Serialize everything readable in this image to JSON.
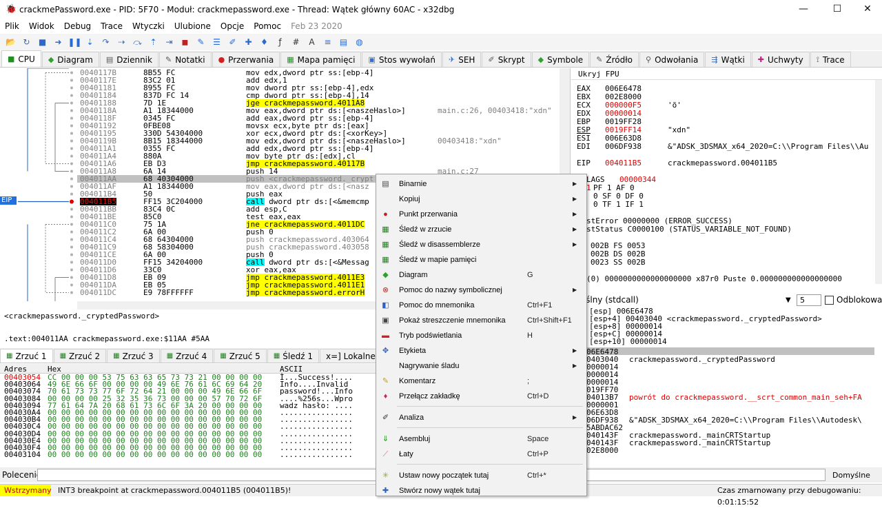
{
  "window": {
    "title": "crackmePassword.exe - PID: 5F70 - Moduł: crackmepassword.exe - Thread: Wątek główny 60AC - x32dbg",
    "controls": [
      "—",
      "☐",
      "✕"
    ]
  },
  "menu": {
    "items": [
      "Plik",
      "Widok",
      "Debug",
      "Trace",
      "Wtyczki",
      "Ulubione",
      "Opcje",
      "Pomoc"
    ],
    "date": "Feb 23 2020"
  },
  "toolbar": {
    "icons": [
      "open-icon",
      "restart-icon",
      "stop-icon",
      "run-icon",
      "pause-icon",
      "step-into-icon",
      "step-over-icon",
      "trace-into-icon",
      "trace-over-icon",
      "execute-till-return-icon",
      "run-to-user-code-icon",
      "animate-icon",
      "breakpoint-icon",
      "patch-icon",
      "comment-icon",
      "label-icon",
      "bookmark-icon",
      "function-icon",
      "hash-icon",
      "font-icon",
      "strings-icon",
      "calculator-icon",
      "help-icon"
    ]
  },
  "tabs": [
    {
      "label": "CPU",
      "icon": "cpu-icon",
      "active": true
    },
    {
      "label": "Diagram",
      "icon": "graph-icon"
    },
    {
      "label": "Dziennik",
      "icon": "log-icon"
    },
    {
      "label": "Notatki",
      "icon": "notes-icon"
    },
    {
      "label": "Przerwania",
      "icon": "breakpoints-icon"
    },
    {
      "label": "Mapa pamięci",
      "icon": "memory-map-icon"
    },
    {
      "label": "Stos wywołań",
      "icon": "callstack-icon"
    },
    {
      "label": "SEH",
      "icon": "seh-icon"
    },
    {
      "label": "Skrypt",
      "icon": "script-icon"
    },
    {
      "label": "Symbole",
      "icon": "symbols-icon"
    },
    {
      "label": "Źródło",
      "icon": "source-icon"
    },
    {
      "label": "Odwołania",
      "icon": "references-icon"
    },
    {
      "label": "Wątki",
      "icon": "threads-icon"
    },
    {
      "label": "Uchwyty",
      "icon": "handles-icon"
    },
    {
      "label": "Trace",
      "icon": "trace-icon"
    }
  ],
  "disasm": {
    "eip_label": "EIP",
    "rows": [
      {
        "addr": "0040117B",
        "bytes": "8B55 FC",
        "dis": "mov edx,dword ptr ss:[ebp-4]",
        "cmt": ""
      },
      {
        "addr": "0040117E",
        "bytes": "83C2 01",
        "dis": "add edx,1",
        "cmt": ""
      },
      {
        "addr": "00401181",
        "bytes": "8955 FC",
        "dis": "mov dword ptr ss:[ebp-4],edx",
        "cmt": ""
      },
      {
        "addr": "00401184",
        "bytes": "837D FC 14",
        "dis": "cmp dword ptr ss:[ebp-4],14",
        "cmt": ""
      },
      {
        "addr": "00401188",
        "bytes": "7D 1E",
        "dis": "jge crackmepassword.4011A8",
        "cmt": ""
      },
      {
        "addr": "0040118A",
        "bytes": "A1 18344000",
        "dis": "mov eax,dword ptr ds:[<naszeHaslo>]",
        "cmt": "main.c:26, 00403418:\"xdn\""
      },
      {
        "addr": "0040118F",
        "bytes": "0345 FC",
        "dis": "add eax,dword ptr ss:[ebp-4]",
        "cmt": ""
      },
      {
        "addr": "00401192",
        "bytes": "0FBE08",
        "dis": "movsx ecx,byte ptr ds:[eax]",
        "cmt": ""
      },
      {
        "addr": "00401195",
        "bytes": "330D 54304000",
        "dis": "xor ecx,dword ptr ds:[<xorKey>]",
        "cmt": ""
      },
      {
        "addr": "0040119B",
        "bytes": "8B15 18344000",
        "dis": "mov edx,dword ptr ds:[<naszeHaslo>]",
        "cmt": "00403418:\"xdn\""
      },
      {
        "addr": "004011A1",
        "bytes": "0355 FC",
        "dis": "add edx,dword ptr ss:[ebp-4]",
        "cmt": ""
      },
      {
        "addr": "004011A4",
        "bytes": "880A",
        "dis": "mov byte ptr ds:[edx],cl",
        "cmt": ""
      },
      {
        "addr": "004011A6",
        "bytes": "EB D3",
        "dis": "jmp crackmepassword.40117B",
        "cmt": ""
      },
      {
        "addr": "004011A8",
        "bytes": "6A 14",
        "dis": "push 14",
        "cmt": "main.c:27"
      },
      {
        "addr": "004011AA",
        "bytes": "68 40304000",
        "dis": "push <crackmepassword._crypt",
        "cmt": ""
      },
      {
        "addr": "004011AF",
        "bytes": "A1 18344000",
        "dis": "mov eax,dword ptr ds:[<nasz",
        "cmt": ""
      },
      {
        "addr": "004011B4",
        "bytes": "50",
        "dis": "push eax",
        "cmt": ""
      },
      {
        "addr": "004011B5",
        "bytes": "FF15 3C204000",
        "dis": "call dword ptr ds:[<&memcmp",
        "cmt": ""
      },
      {
        "addr": "004011BB",
        "bytes": "83C4 0C",
        "dis": "add esp,C",
        "cmt": ""
      },
      {
        "addr": "004011BE",
        "bytes": "85C0",
        "dis": "test eax,eax",
        "cmt": ""
      },
      {
        "addr": "004011C0",
        "bytes": "75 1A",
        "dis": "jne crackmepassword.4011DC",
        "cmt": ""
      },
      {
        "addr": "004011C2",
        "bytes": "6A 00",
        "dis": "push 0",
        "cmt": ""
      },
      {
        "addr": "004011C4",
        "bytes": "68 64304000",
        "dis": "push crackmepassword.403064",
        "cmt": ""
      },
      {
        "addr": "004011C9",
        "bytes": "68 58304000",
        "dis": "push crackmepassword.403058",
        "cmt": ""
      },
      {
        "addr": "004011CE",
        "bytes": "6A 00",
        "dis": "push 0",
        "cmt": ""
      },
      {
        "addr": "004011D0",
        "bytes": "FF15 34204000",
        "dis": "call dword ptr ds:[<&Messag",
        "cmt": ""
      },
      {
        "addr": "004011D6",
        "bytes": "33C0",
        "dis": "xor eax,eax",
        "cmt": ""
      },
      {
        "addr": "004011D8",
        "bytes": "EB 09",
        "dis": "jmp crackmepassword.4011E3",
        "cmt": ""
      },
      {
        "addr": "004011DA",
        "bytes": "EB 05",
        "dis": "jmp crackmepassword.4011E1",
        "cmt": ""
      },
      {
        "addr": "004011DC",
        "bytes": "E9 78FFFFFF",
        "dis": "jmp crackmepassword.errorH",
        "cmt": ""
      }
    ]
  },
  "registers": {
    "header": "Ukryj FPU",
    "general": [
      {
        "name": "EAX",
        "value": "006E6478",
        "desc": ""
      },
      {
        "name": "EBX",
        "value": "002E8000",
        "desc": ""
      },
      {
        "name": "ECX",
        "value": "000000F5",
        "desc": "'õ'"
      },
      {
        "name": "EDX",
        "value": "00000014",
        "desc": ""
      },
      {
        "name": "EBP",
        "value": "0019FF28",
        "desc": ""
      },
      {
        "name": "ESP",
        "value": "0019FF14",
        "desc": "\"xdn\""
      },
      {
        "name": "ESI",
        "value": "006E63D8",
        "desc": ""
      },
      {
        "name": "EDI",
        "value": "006DF938",
        "desc": "&\"ADSK_3DSMAX_x64_2020=C:\\\\Program Files\\\\Au"
      }
    ],
    "eip": {
      "name": "EIP",
      "value": "004011B5",
      "desc": "crackmepassword.004011B5"
    },
    "eflags": {
      "name": "LAGS",
      "value": "00000344"
    },
    "flags": [
      "PF 1  AF 0",
      "0  SF 0  DF 0",
      "0  TF 1  IF 1"
    ],
    "flag_prefix": [
      "1",
      "",
      ""
    ],
    "last_error": "stError  00000000 (ERROR_SUCCESS)",
    "last_status": "stStatus C0000100 (STATUS_VARIABLE_NOT_FOUND)",
    "segments": [
      "002B  FS 0053",
      "002B  DS 002B",
      "0023  SS 002B"
    ],
    "fpu": "(0) 0000000000000000000 x87r0 Puste 0.000000000000000000"
  },
  "callconv": {
    "label": "yślny (stdcall)",
    "count": "5",
    "checkbox_label": "Odblokowany"
  },
  "stack_args": [
    "[esp] 006E6478",
    "[esp+4] 00403040 <crackmepassword._cryptedPassword>",
    "[esp+8] 00000014",
    "[esp+C] 00000014",
    "[esp+10] 00000014"
  ],
  "stack": [
    {
      "addr": "06E6478",
      "cmt": "",
      "red": false
    },
    {
      "addr": "0403040",
      "cmt": "crackmepassword._cryptedPassword",
      "red": false
    },
    {
      "addr": "0000014",
      "cmt": "",
      "red": false
    },
    {
      "addr": "0000014",
      "cmt": "",
      "red": false
    },
    {
      "addr": "0000014",
      "cmt": "",
      "red": false
    },
    {
      "addr": "019FF70",
      "cmt": "",
      "red": false
    },
    {
      "addr": "04013B7",
      "cmt": "powrót do crackmepassword.__scrt_common_main_seh+FA",
      "red": true
    },
    {
      "addr": "0000001",
      "cmt": "",
      "red": false
    },
    {
      "addr": "06E63D8",
      "cmt": "",
      "red": false
    },
    {
      "addr": "06DF938",
      "cmt": "&\"ADSK_3DSMAX_x64_2020=C:\\\\Program Files\\\\Autodesk\\",
      "red": false
    },
    {
      "addr": "5ABDAC62",
      "cmt": "",
      "red": false
    },
    {
      "addr": "040143F",
      "cmt": "crackmepassword._mainCRTStartup",
      "red": false
    },
    {
      "addr": "040143F",
      "cmt": "crackmepassword._mainCRTStartup",
      "red": false
    },
    {
      "addr": "02E8000",
      "cmt": "",
      "red": false
    }
  ],
  "info": {
    "line1": "<crackmepassword._cryptedPassword>",
    "line2": ".text:004011AA crackmepassword.exe:$11AA #5AA"
  },
  "dump_tabs": [
    "Zrzuć 1",
    "Zrzuć 2",
    "Zrzuć 3",
    "Zrzuć 4",
    "Zrzuć 5",
    "Śledź 1",
    "x=] Lokalne"
  ],
  "dump": {
    "headers": [
      "Adres",
      "Hex",
      "ASCII"
    ],
    "rows": [
      {
        "addr": "00403054",
        "hex": "CC 00 00 00 53 75 63 63 65 73 73 21 00 00 00 00",
        "ascii": "Ì...Success!...."
      },
      {
        "addr": "00403064",
        "hex": "49 6E 66 6F 00 00 00 00 49 6E 76 61 6C 69 64 20",
        "ascii": "Info....Invalid "
      },
      {
        "addr": "00403074",
        "hex": "70 61 73 73 77 6F 72 64 21 00 00 00 49 6E 66 6F",
        "ascii": "password!...Info"
      },
      {
        "addr": "00403084",
        "hex": "00 00 00 00 25 32 35 36 73 00 00 00 57 70 72 6F",
        "ascii": "....%256s...Wpro"
      },
      {
        "addr": "00403094",
        "hex": "77 61 64 7A 20 68 61 73 6C 6F 3A 20 00 00 00 00",
        "ascii": "wadz hasło: ...."
      },
      {
        "addr": "004030A4",
        "hex": "00 00 00 00 00 00 00 00 00 00 00 00 00 00 00 00",
        "ascii": "................"
      },
      {
        "addr": "004030B4",
        "hex": "00 00 00 00 00 00 00 00 00 00 00 00 00 00 00 00",
        "ascii": "................"
      },
      {
        "addr": "004030C4",
        "hex": "00 00 00 00 00 00 00 00 00 00 00 00 00 00 00 00",
        "ascii": "................"
      },
      {
        "addr": "004030D4",
        "hex": "00 00 00 00 00 00 00 00 00 00 00 00 00 00 00 00",
        "ascii": "................"
      },
      {
        "addr": "004030E4",
        "hex": "00 00 00 00 00 00 00 00 00 00 00 00 00 00 00 00",
        "ascii": "................"
      },
      {
        "addr": "004030F4",
        "hex": "00 00 00 00 00 00 00 00 00 00 00 00 00 00 00 00",
        "ascii": "................"
      },
      {
        "addr": "00403104",
        "hex": "00 00 00 00 00 00 00 00 00 00 00 00 00 00 00 00",
        "ascii": "................"
      }
    ]
  },
  "command": {
    "label": "Polecenie:",
    "value": "",
    "dropdown": "Domyślne"
  },
  "status": {
    "state": "Wstrzymany",
    "message": "INT3 breakpoint at crackmepassword.004011B5 (004011B5)!",
    "time": "Czas zmarnowany przy debugowaniu: 0:01:15:52"
  },
  "context_menu": [
    {
      "label": "Binarnie",
      "shortcut": "",
      "submenu": true,
      "icon": "binary-icon"
    },
    {
      "label": "Kopiuj",
      "shortcut": "",
      "submenu": true,
      "icon": "copy-icon"
    },
    {
      "label": "Punkt przerwania",
      "shortcut": "",
      "submenu": true,
      "icon": "breakpoint-dot-icon"
    },
    {
      "label": "Śledź w zrzucie",
      "shortcut": "",
      "submenu": true,
      "icon": "dump-icon"
    },
    {
      "label": "Śledź w disassemblerze",
      "shortcut": "",
      "submenu": true,
      "icon": "disassembler-icon"
    },
    {
      "label": "Śledź w mapie pamięci",
      "shortcut": "",
      "submenu": false,
      "icon": "memory-map-icon"
    },
    {
      "label": "Diagram",
      "shortcut": "G",
      "submenu": false,
      "icon": "graph-icon"
    },
    {
      "label": "Pomoc do nazwy symbolicznej",
      "shortcut": "",
      "submenu": true,
      "icon": "help-symbol-icon"
    },
    {
      "label": "Pomoc do mnemonika",
      "shortcut": "Ctrl+F1",
      "submenu": false,
      "icon": "help-mnemonic-icon"
    },
    {
      "label": "Pokaż streszczenie mnemonika",
      "shortcut": "Ctrl+Shift+F1",
      "submenu": false,
      "icon": "mnemonic-brief-icon"
    },
    {
      "label": "Tryb podświetlania",
      "shortcut": "H",
      "submenu": false,
      "icon": "highlight-icon"
    },
    {
      "label": "Etykieta",
      "shortcut": "",
      "submenu": true,
      "icon": "label-icon"
    },
    {
      "label": "Nagrywanie śladu",
      "shortcut": "",
      "submenu": true,
      "icon": "trace-record-icon"
    },
    {
      "label": "Komentarz",
      "shortcut": ";",
      "submenu": false,
      "icon": "comment-icon"
    },
    {
      "label": "Przełącz zakładkę",
      "shortcut": "Ctrl+D",
      "submenu": false,
      "icon": "bookmark-icon"
    },
    {
      "label": "Analiza",
      "shortcut": "",
      "submenu": true,
      "icon": "analysis-icon"
    },
    {
      "label": "Asembluj",
      "shortcut": "Space",
      "submenu": false,
      "icon": "assemble-icon"
    },
    {
      "label": "Łaty",
      "shortcut": "Ctrl+P",
      "submenu": false,
      "icon": "patch-icon"
    },
    {
      "label": "Ustaw nowy początek tutaj",
      "shortcut": "Ctrl+*",
      "submenu": false,
      "icon": "set-origin-icon"
    },
    {
      "label": "Stwórz nowy wątek tutaj",
      "shortcut": "",
      "submenu": false,
      "icon": "new-thread-icon"
    }
  ],
  "colors": {
    "accent": "#2070e0",
    "highlight_yellow": "#ffff00",
    "highlight_cyan": "#00ffff",
    "eip_red": "#ff0000"
  }
}
